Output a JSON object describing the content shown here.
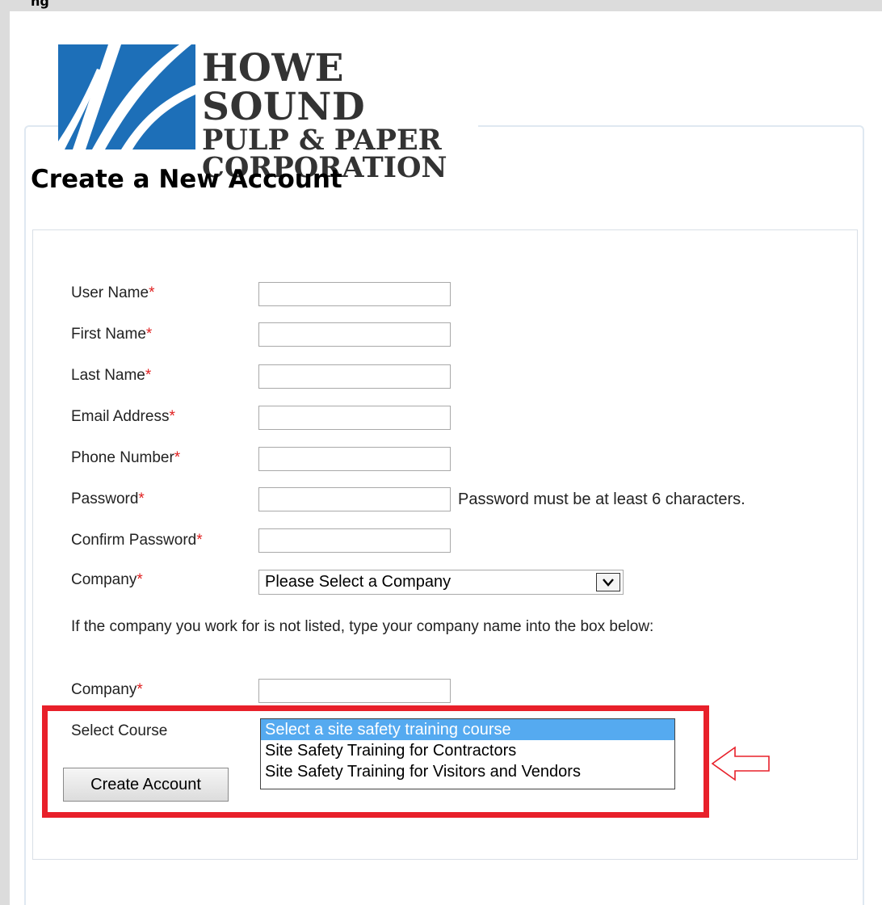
{
  "top_title": "ng",
  "logo": {
    "line1": "HOWE SOUND",
    "line2": "PULP & PAPER",
    "line3": "CORPORATION"
  },
  "heading": "Create a New Account",
  "form": {
    "required_marker": "*",
    "fields": [
      {
        "label": "User Name",
        "value": ""
      },
      {
        "label": "First Name",
        "value": ""
      },
      {
        "label": "Last Name",
        "value": ""
      },
      {
        "label": "Email Address",
        "value": ""
      },
      {
        "label": "Phone Number",
        "value": ""
      },
      {
        "label": "Password",
        "value": ""
      },
      {
        "label": "Confirm Password",
        "value": ""
      }
    ],
    "password_hint": "Password must be at least 6 characters.",
    "company_label": "Company",
    "company_select_value": "Please Select a Company",
    "company_note": "If the company you work for is not listed, type your company name into the box below:",
    "company_text_label": "Company",
    "company_text_value": "",
    "course_label": "Select Course",
    "course_options": [
      "Select a site safety training course",
      "Site Safety Training for Contractors",
      "Site Safety Training for Visitors and Vendors"
    ],
    "course_selected_index": 0,
    "submit_label": "Create Account"
  },
  "colors": {
    "required": "#e02020",
    "highlight_box": "#e8202a",
    "listbox_selected": "#55aaf0",
    "logo_blue": "#1d6fb8"
  }
}
